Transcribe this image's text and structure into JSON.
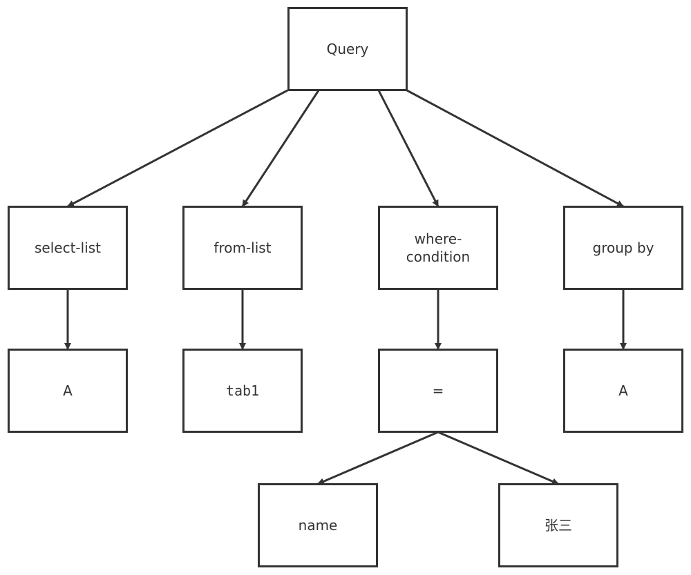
{
  "diagram": {
    "type": "tree",
    "nodes": [
      {
        "id": "query",
        "label": "Query"
      },
      {
        "id": "select_list",
        "label": "select-list"
      },
      {
        "id": "from_list",
        "label": "from-list"
      },
      {
        "id": "where_condition",
        "label": "where-\ncondition"
      },
      {
        "id": "group_by",
        "label": "group by"
      },
      {
        "id": "select_a",
        "label": "A"
      },
      {
        "id": "tab1",
        "label": "tab1"
      },
      {
        "id": "equals",
        "label": "="
      },
      {
        "id": "group_a",
        "label": "A"
      },
      {
        "id": "name",
        "label": "name"
      },
      {
        "id": "zhangsan",
        "label": "张三"
      }
    ],
    "edges": [
      {
        "from": "query",
        "to": "select_list"
      },
      {
        "from": "query",
        "to": "from_list"
      },
      {
        "from": "query",
        "to": "where_condition"
      },
      {
        "from": "query",
        "to": "group_by"
      },
      {
        "from": "select_list",
        "to": "select_a"
      },
      {
        "from": "from_list",
        "to": "tab1"
      },
      {
        "from": "where_condition",
        "to": "equals"
      },
      {
        "from": "group_by",
        "to": "group_a"
      },
      {
        "from": "equals",
        "to": "name"
      },
      {
        "from": "equals",
        "to": "zhangsan"
      }
    ],
    "colors": {
      "stroke": "#333333",
      "text": "#333333",
      "background": "#ffffff"
    }
  }
}
